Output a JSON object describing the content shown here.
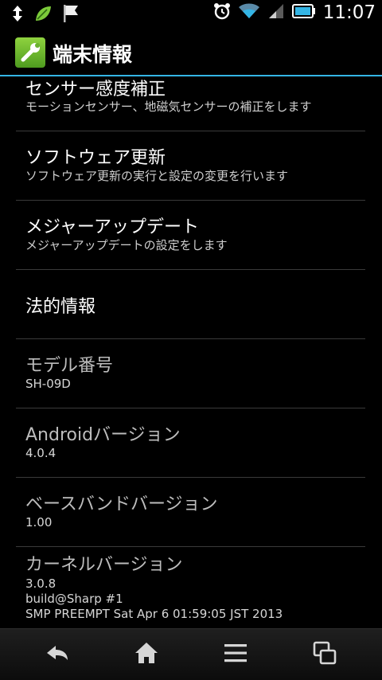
{
  "status_bar": {
    "time": "11:07",
    "icons_left": [
      "usb-transfer-icon",
      "leaf-notification-icon",
      "flag-notification-icon"
    ],
    "icons_right": [
      "alarm-clock-icon",
      "wifi-icon",
      "cell-signal-icon",
      "battery-icon"
    ]
  },
  "action_bar": {
    "title": "端末情報",
    "icon": "wrench-settings-icon"
  },
  "items": [
    {
      "title": "センサー感度補正",
      "summary": "モーションセンサー、地磁気センサーの補正をします"
    },
    {
      "title": "ソフトウェア更新",
      "summary": "ソフトウェア更新の実行と設定の変更を行います"
    },
    {
      "title": "メジャーアップデート",
      "summary": "メジャーアップデートの設定をします"
    },
    {
      "title": "法的情報"
    },
    {
      "title": "モデル番号",
      "summary": "SH-09D"
    },
    {
      "title": "Androidバージョン",
      "summary": "4.0.4"
    },
    {
      "title": "ベースバンドバージョン",
      "summary": "1.00"
    },
    {
      "title": "カーネルバージョン",
      "summary_lines": [
        "3.0.8",
        "build@Sharp #1",
        "SMP PREEMPT Sat Apr 6 01:59:05 JST 2013"
      ]
    }
  ],
  "nav_bar": {
    "buttons": [
      "back-icon",
      "home-icon",
      "menu-icon",
      "recent-apps-icon"
    ]
  },
  "colors": {
    "accent": "#34b5e5",
    "background": "#000000",
    "divider": "#3a3a3a"
  }
}
